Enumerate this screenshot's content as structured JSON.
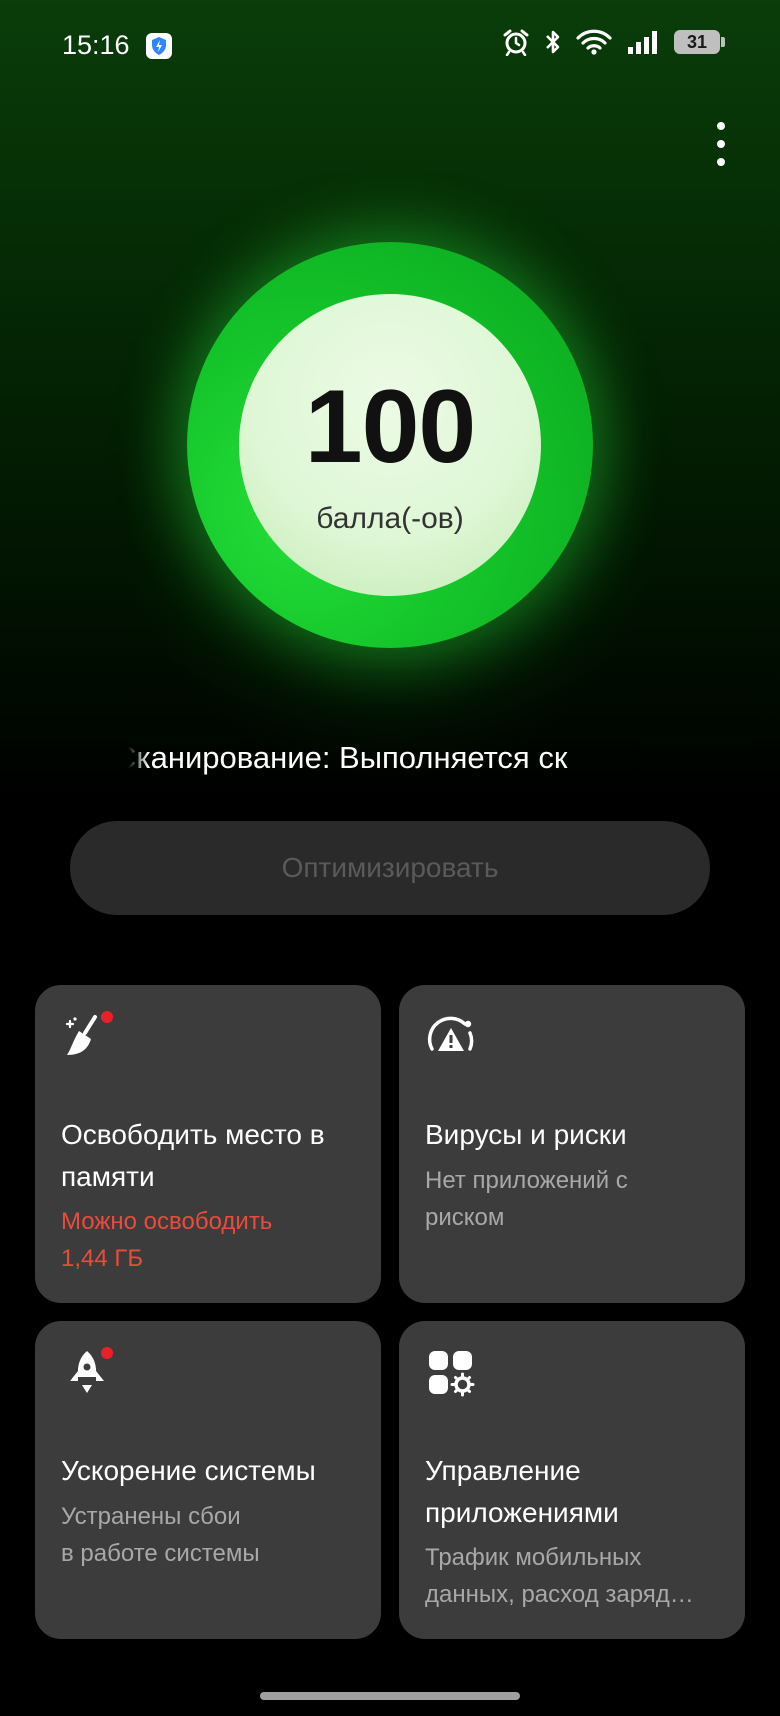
{
  "status_bar": {
    "time": "15:16",
    "battery": "31"
  },
  "score": {
    "value": "100",
    "unit": "балла(-ов)"
  },
  "scan_status": "Сканирование:  Выполняется ск",
  "optimize_button": "Оптимизировать",
  "cards": [
    {
      "title": "Освободить место в памяти",
      "sub_line1": "Можно освободить",
      "sub_line2": "1,44 ГБ"
    },
    {
      "title": "Вирусы и риски",
      "sub_line1": "Нет приложений с",
      "sub_line2": "риском"
    },
    {
      "title": "Ускорение системы",
      "sub_line1": "Устранены сбои",
      "sub_line2": "в работе системы"
    },
    {
      "title_line1": "Управление",
      "title_line2": "приложениями",
      "sub_line1": "Трафик мобильных",
      "sub_line2": "данных, расход заряд…"
    }
  ],
  "colors": {
    "accent_green": "#14c42a",
    "warning_red": "#ea4b3a",
    "card_bg": "#3c3c3c",
    "notification_dot": "#e8222a"
  },
  "icons": {
    "app_badge": "shield-lightning-icon",
    "alarm": "alarm-clock-icon",
    "bluetooth": "bluetooth-icon",
    "wifi": "wifi-icon",
    "signal": "cellular-signal-icon",
    "more": "more-vertical-icon",
    "clean": "broom-icon",
    "virus": "warning-radar-icon",
    "speed": "rocket-icon",
    "apps": "apps-grid-gear-icon"
  }
}
